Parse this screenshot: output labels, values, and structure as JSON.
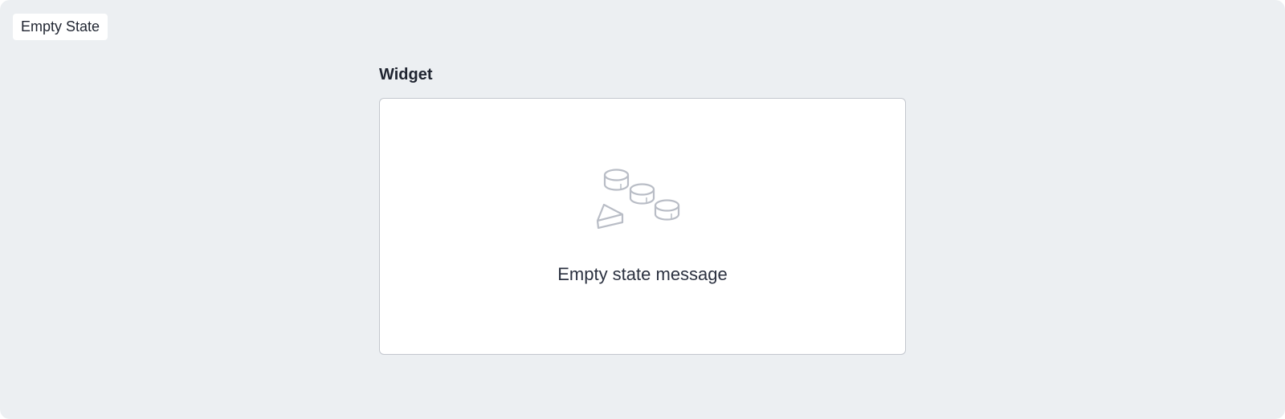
{
  "tag": {
    "label": "Empty State"
  },
  "widget": {
    "title": "Widget",
    "empty_message": "Empty state message",
    "illustration_icon": "empty-pieces-icon"
  },
  "colors": {
    "background": "#eceff2",
    "panel_border": "#c3c7ce",
    "illustration_stroke": "#b9bdc6",
    "text": "#1f2430"
  }
}
